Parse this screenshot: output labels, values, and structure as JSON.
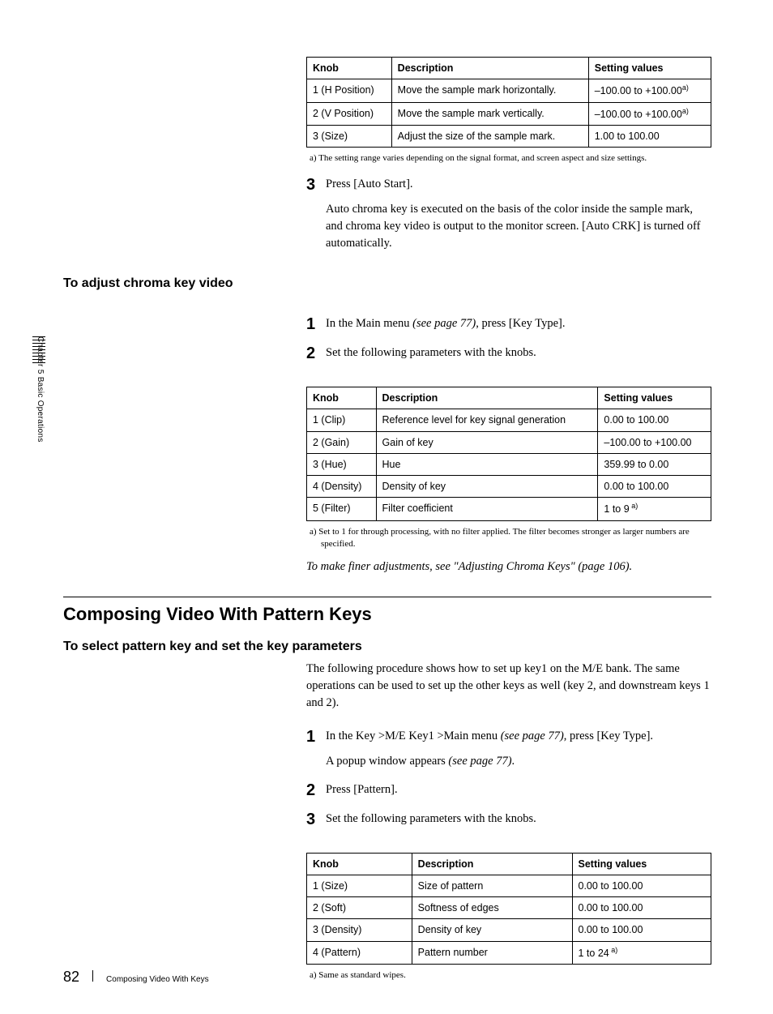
{
  "side": {
    "chapter": "Chapter 5  Basic Operations"
  },
  "table1": {
    "headers": [
      "Knob",
      "Description",
      "Setting values"
    ],
    "rows": [
      {
        "knob": "1 (H Position)",
        "desc": "Move the sample mark horizontally.",
        "val": "–100.00 to +100.00",
        "sup": "a)"
      },
      {
        "knob": "2 (V Position)",
        "desc": "Move the sample mark vertically.",
        "val": "–100.00 to +100.00",
        "sup": "a)"
      },
      {
        "knob": "3 (Size)",
        "desc": "Adjust the size of the sample mark.",
        "val": "1.00 to 100.00",
        "sup": ""
      }
    ],
    "footnote": "a) The setting range varies depending on the signal format, and screen aspect and size settings."
  },
  "step3": {
    "num": "3",
    "line1": "Press [Auto Start].",
    "para": "Auto chroma key is executed on the basis of the color inside the sample mark, and chroma key video is output to the monitor screen. [Auto CRK] is turned off automatically."
  },
  "subhead1": "To adjust chroma key video",
  "ck_step1": {
    "num": "1",
    "pre": "In the Main menu ",
    "ref": "(see page 77)",
    "post": ", press [Key Type]."
  },
  "ck_step2": {
    "num": "2",
    "text": "Set the following parameters with the knobs."
  },
  "table2": {
    "headers": [
      "Knob",
      "Description",
      "Setting values"
    ],
    "rows": [
      {
        "knob": "1 (Clip)",
        "desc": "Reference level for key signal generation",
        "val": "0.00 to 100.00",
        "sup": ""
      },
      {
        "knob": "2 (Gain)",
        "desc": "Gain of key",
        "val": "–100.00 to +100.00",
        "sup": ""
      },
      {
        "knob": "3 (Hue)",
        "desc": "Hue",
        "val": "359.99 to 0.00",
        "sup": ""
      },
      {
        "knob": "4 (Density)",
        "desc": "Density of key",
        "val": "0.00 to 100.00",
        "sup": ""
      },
      {
        "knob": "5 (Filter)",
        "desc": "Filter coefficient",
        "val": "1 to 9",
        "sup": " a)"
      }
    ],
    "footnote": "a) Set to 1 for through processing, with no filter applied. The filter becomes stronger as larger numbers are specified.",
    "crossref": "To make finer adjustments, see \"Adjusting Chroma Keys\" (page 106)."
  },
  "section_title": "Composing Video With Pattern Keys",
  "subhead2": "To select pattern key and set the key parameters",
  "pk_intro": "The following procedure shows how to set up key1 on the M/E bank. The same operations can be used to set up the other keys as well (key 2, and downstream keys 1 and 2).",
  "pk_step1": {
    "num": "1",
    "pre": "In the Key >M/E Key1 >Main menu ",
    "ref": "(see page 77)",
    "post": ", press [Key Type].",
    "sub_pre": "A popup window appears ",
    "sub_ref": "(see page 77)",
    "sub_post": "."
  },
  "pk_step2": {
    "num": "2",
    "text": "Press [Pattern]."
  },
  "pk_step3": {
    "num": "3",
    "text": "Set the following parameters with the knobs."
  },
  "table3": {
    "headers": [
      "Knob",
      "Description",
      "Setting values"
    ],
    "rows": [
      {
        "knob": "1 (Size)",
        "desc": "Size of pattern",
        "val": "0.00 to 100.00",
        "sup": ""
      },
      {
        "knob": "2 (Soft)",
        "desc": "Softness of edges",
        "val": "0.00 to 100.00",
        "sup": ""
      },
      {
        "knob": "3 (Density)",
        "desc": "Density of key",
        "val": "0.00 to 100.00",
        "sup": ""
      },
      {
        "knob": "4 (Pattern)",
        "desc": "Pattern number",
        "val": "1 to 24",
        "sup": " a)"
      }
    ],
    "footnote": "a) Same as standard wipes."
  },
  "footer": {
    "page": "82",
    "title": "Composing Video With Keys"
  }
}
